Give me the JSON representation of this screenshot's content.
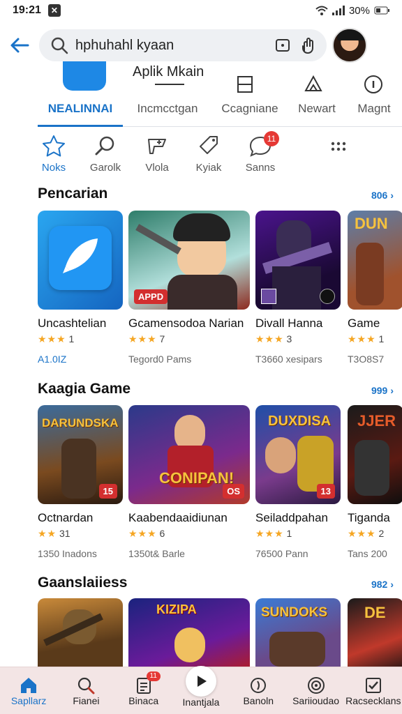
{
  "status": {
    "time": "19:21",
    "battery": "30%"
  },
  "search": {
    "value": "hphuhahl kyaan"
  },
  "category_strip": {
    "title": "Aplik Mkain"
  },
  "tabs": [
    {
      "label": "NEALINNAI",
      "active": true
    },
    {
      "label": "Incmcctgan",
      "active": false
    },
    {
      "label": "Ccagniane",
      "active": false
    },
    {
      "label": "Newart",
      "active": false
    },
    {
      "label": "Magnt",
      "active": false
    }
  ],
  "chips": [
    {
      "label": "Noks",
      "icon": "star-icon",
      "active": true
    },
    {
      "label": "Garolk",
      "icon": "search-icon"
    },
    {
      "label": "Vlola",
      "icon": "game-icon"
    },
    {
      "label": "Kyiak",
      "icon": "tag-icon"
    },
    {
      "label": "Sanns",
      "icon": "chat-icon",
      "badge": "11"
    },
    {
      "label": "",
      "icon": "more-icon"
    }
  ],
  "sections": [
    {
      "title": "Pencarian",
      "link": "806",
      "cards": [
        {
          "name": "Uncashtelian",
          "rating": "1",
          "meta": "A1.0IZ",
          "tag": ""
        },
        {
          "name": "Gcamensodoa Narian",
          "rating": "7",
          "meta": "Tegord0 Pams",
          "tag": "APPD"
        },
        {
          "name": "Divall Hanna",
          "rating": "3",
          "meta": "T3660 xesipars",
          "tag": ""
        },
        {
          "name": "Game",
          "rating": "1",
          "meta": "T3O8S7",
          "tag": "DUN"
        }
      ]
    },
    {
      "title": "Kaagia Game",
      "link": "999",
      "cards": [
        {
          "name": "Octnardan",
          "rating": "31",
          "meta": "1350 Inadons",
          "tag": "15",
          "art": "DARUNDSKA"
        },
        {
          "name": "Kaabendaaidiunan",
          "rating": "6",
          "meta": "1350t& Barle",
          "tag": "OS",
          "art": "CONIPAN!"
        },
        {
          "name": "Seiladdpahan",
          "rating": "1",
          "meta": "76500 Pann",
          "tag": "13",
          "art": "DUXDISA"
        },
        {
          "name": "Tiganda",
          "rating": "2",
          "meta": "Tans 200",
          "tag": "",
          "art": "JJER"
        }
      ]
    },
    {
      "title": "Gaanslaiiess",
      "link": "982",
      "cards": [
        {
          "name": "",
          "art": ""
        },
        {
          "name": "",
          "art": "KIZIPA"
        },
        {
          "name": "",
          "art": "SUNDOKS"
        },
        {
          "name": "",
          "art": "DE"
        }
      ]
    }
  ],
  "bottom_nav": [
    {
      "label": "Sapllarz",
      "icon": "home-icon",
      "active": true
    },
    {
      "label": "Fianei",
      "icon": "search-icon"
    },
    {
      "label": "Binaca",
      "icon": "library-icon",
      "badge": "11"
    },
    {
      "label": "Inantjala",
      "icon": "play-icon"
    },
    {
      "label": "Banoln",
      "icon": "clock-icon"
    },
    {
      "label": "Sariioudao",
      "icon": "target-icon"
    },
    {
      "label": "Racsecklans",
      "icon": "check-icon"
    }
  ],
  "colors": {
    "accent": "#1a73c8",
    "badge": "#e53935",
    "star": "#f5a623",
    "nav_bg": "#f3e5e5"
  }
}
